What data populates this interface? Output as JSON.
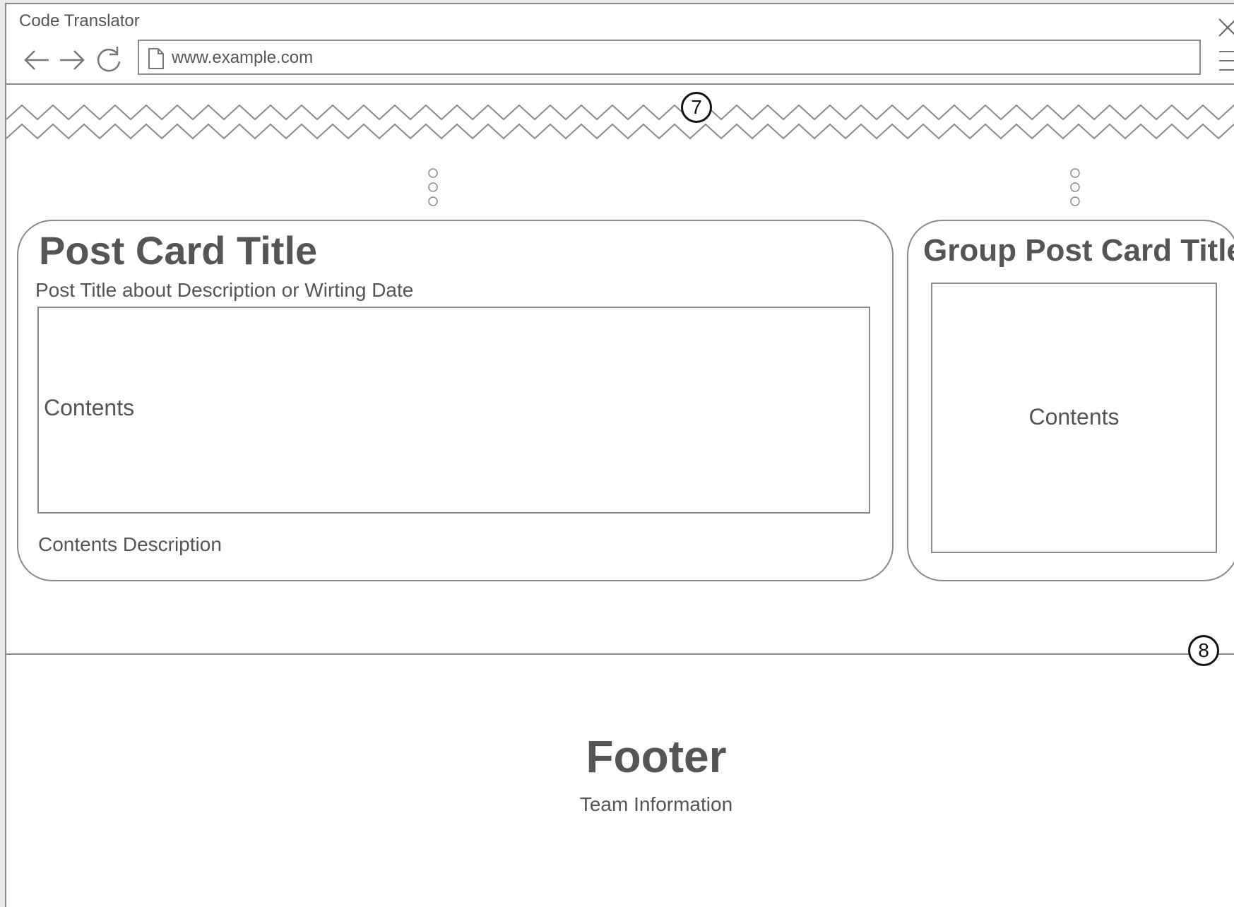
{
  "window": {
    "title": "Code Translator"
  },
  "toolbar": {
    "url": "www.example.com"
  },
  "icons": {
    "close": "close-icon",
    "back": "back-arrow-icon",
    "forward": "forward-arrow-icon",
    "reload": "reload-icon",
    "page": "page-icon",
    "menu": "hamburger-menu-icon"
  },
  "annotations": {
    "top_marker": "7",
    "footer_marker": "8"
  },
  "post_card": {
    "title": "Post Card Title",
    "subtitle": "Post Title about Description or Wirting Date",
    "content_label": "Contents",
    "description": "Contents Description"
  },
  "group_card": {
    "title": "Group Post Card Title",
    "content_label": "Contents"
  },
  "footer": {
    "title": "Footer",
    "subtitle": "Team Information"
  },
  "colors": {
    "line": "#8a8a8a",
    "text": "#555555",
    "background": "#ffffff"
  }
}
